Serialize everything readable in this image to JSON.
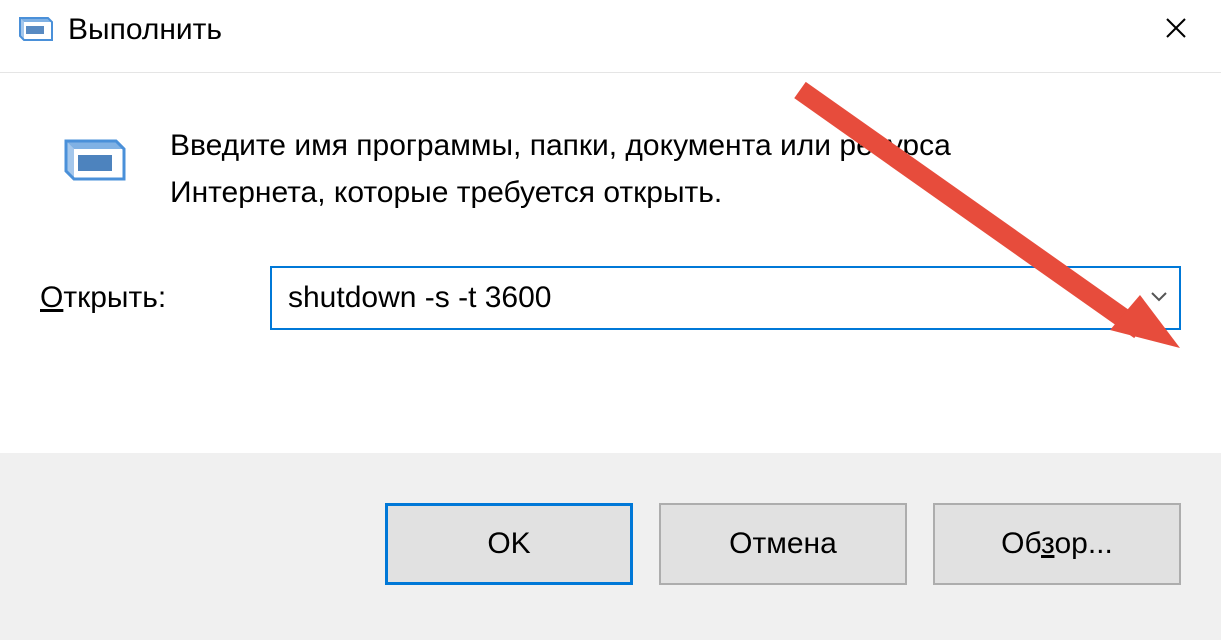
{
  "titlebar": {
    "title": "Выполнить"
  },
  "content": {
    "description": "Введите имя программы, папки, документа или ресурса Интернета, которые требуется открыть.",
    "open_label_prefix": "О",
    "open_label_rest": "ткрыть:"
  },
  "input": {
    "value": "shutdown -s -t 3600"
  },
  "buttons": {
    "ok": "OK",
    "cancel": "Отмена",
    "browse_prefix": "Об",
    "browse_ul": "з",
    "browse_suffix": "ор..."
  }
}
